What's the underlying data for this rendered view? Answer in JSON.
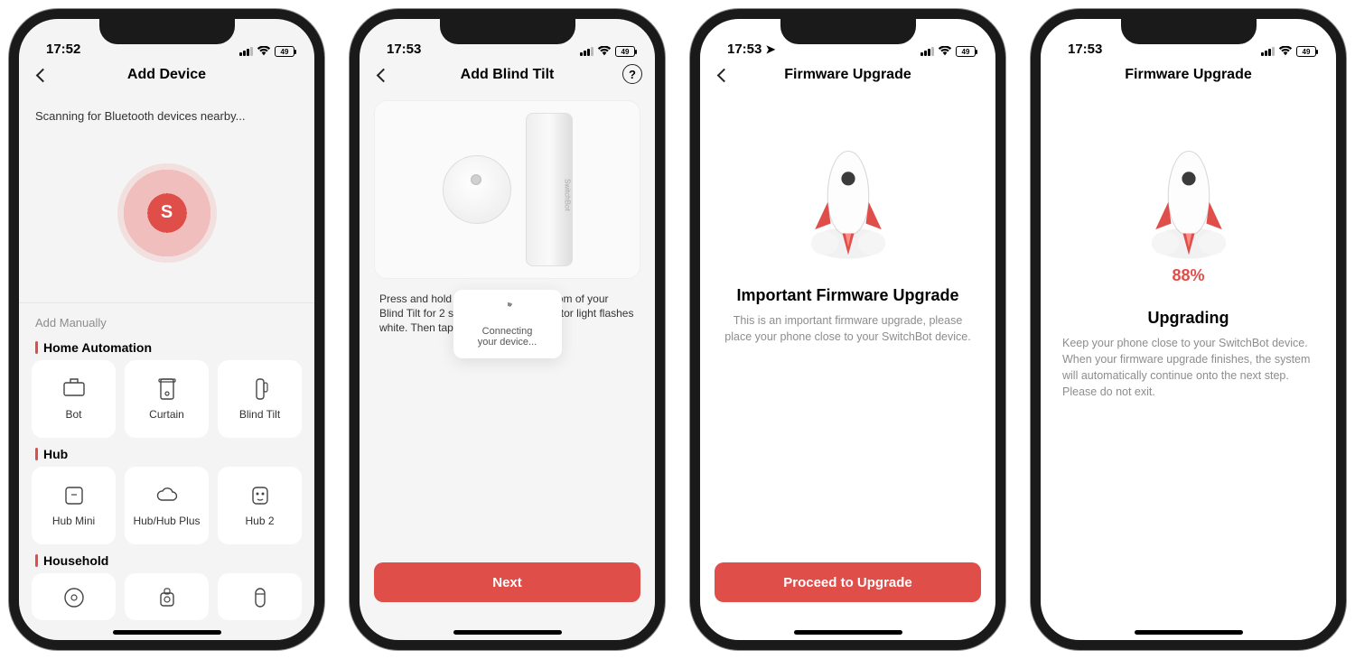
{
  "status": {
    "battery_label": "49"
  },
  "phone1": {
    "time": "17:52",
    "title": "Add Device",
    "scanning_text": "Scanning for Bluetooth devices nearby...",
    "logo_letter": "S",
    "add_manually_label": "Add Manually",
    "sections": {
      "home_automation": {
        "title": "Home Automation",
        "items": [
          "Bot",
          "Curtain",
          "Blind Tilt"
        ]
      },
      "hub": {
        "title": "Hub",
        "items": [
          "Hub Mini",
          "Hub/Hub Plus",
          "Hub 2"
        ]
      },
      "household": {
        "title": "Household"
      }
    }
  },
  "phone2": {
    "time": "17:53",
    "title": "Add Blind Tilt",
    "product_label": "SwitchBot",
    "instruction": "Press and hold the button on the bottom of your Blind Tilt for 2 seconds until the indicator light flashes white. Then tap Next.",
    "connecting_title": "Connecting",
    "connecting_sub": "your device...",
    "cta": "Next"
  },
  "phone3": {
    "time": "17:53",
    "show_location": true,
    "title": "Firmware Upgrade",
    "heading": "Important Firmware Upgrade",
    "body": "This is an important firmware upgrade, please place your phone close to your SwitchBot device.",
    "cta": "Proceed to Upgrade"
  },
  "phone4": {
    "time": "17:53",
    "title": "Firmware Upgrade",
    "percent": "88%",
    "heading": "Upgrading",
    "body": "Keep your phone close to your SwitchBot device. When your firmware upgrade finishes, the system will automatically continue onto the next step. Please do not exit."
  }
}
